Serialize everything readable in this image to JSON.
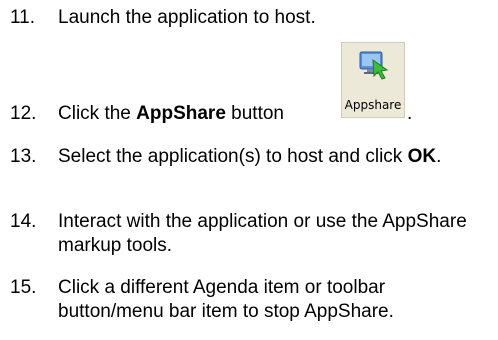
{
  "steps": [
    {
      "num": "11.",
      "text": "Launch the application to host."
    },
    {
      "num": "12.",
      "pre": "Click the ",
      "bold": "AppShare",
      "post": " button",
      "end": "."
    },
    {
      "num": "13.",
      "pre": "Select the application(s) to host and click ",
      "bold": "OK",
      "post": "."
    },
    {
      "num": "14.",
      "text": "Interact with the application or use the AppShare markup tools."
    },
    {
      "num": "15.",
      "text": "Click a different Agenda item or toolbar button/menu bar item to stop AppShare."
    }
  ],
  "appshare_button": {
    "label": "Appshare",
    "icon": "monitor-with-arrow-icon"
  }
}
